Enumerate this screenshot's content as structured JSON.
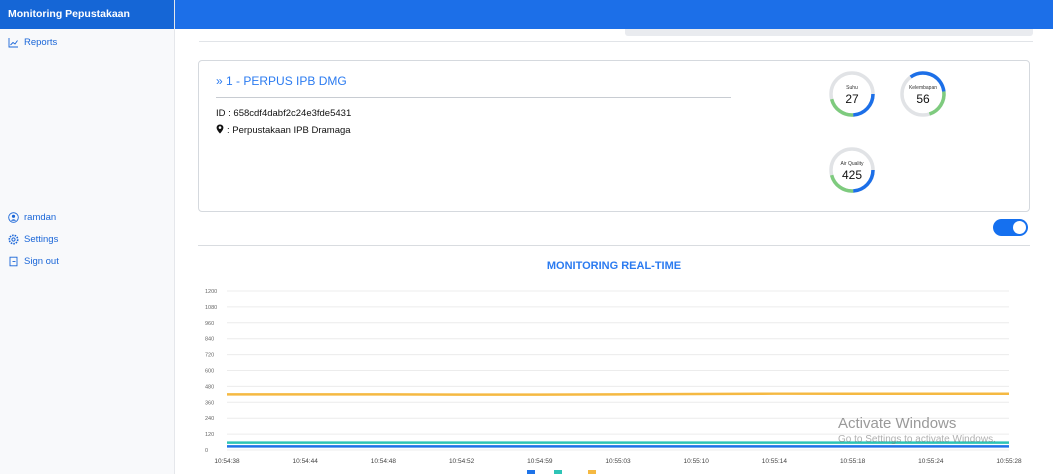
{
  "app": {
    "title": "Monitoring Pepustakaan"
  },
  "sidebar": {
    "top_items": [
      {
        "label": "Reports",
        "icon": "chart-line-icon"
      }
    ],
    "bottom_items": [
      {
        "label": "ramdan",
        "icon": "user-circle-icon"
      },
      {
        "label": "Settings",
        "icon": "gear-icon"
      },
      {
        "label": "Sign out",
        "icon": "sign-out-icon"
      }
    ]
  },
  "device_card": {
    "title": "» 1 - PERPUS IPB DMG",
    "id_text": "ID : 658cdf4dabf2c24e3fde5431",
    "location_text": ": Perpustakaan IPB Dramaga",
    "gauges": [
      {
        "label": "Suhu",
        "value": "27",
        "color": "#1c6fe8",
        "secondary_color": "#7ecb7e"
      },
      {
        "label": "Kelembapan",
        "value": "56",
        "color": "#1c6fe8",
        "secondary_color": "#7ecb7e"
      },
      {
        "label": "Air Quality",
        "value": "425",
        "color": "#1c6fe8",
        "secondary_color": "#7ecb7e"
      }
    ]
  },
  "toggle": {
    "on": true
  },
  "monitoring": {
    "title": "MONITORING REAL-TIME"
  },
  "chart_data": {
    "type": "line",
    "title": "",
    "categories": [
      "10:54:38",
      "10:54:44",
      "10:54:48",
      "10:54:52",
      "10:54:59",
      "10:55:03",
      "10:55:10",
      "10:55:14",
      "10:55:18",
      "10:55:24",
      "10:55:28"
    ],
    "yticks": [
      0,
      120,
      240,
      360,
      480,
      600,
      720,
      840,
      960,
      1080,
      1200
    ],
    "ylim": [
      0,
      1200
    ],
    "grid": true,
    "series": [
      {
        "values": [
          27,
          27,
          27,
          27,
          27,
          27,
          27,
          27,
          27,
          27,
          27
        ],
        "color": "#1e73e8"
      },
      {
        "values": [
          56,
          56,
          56,
          56,
          56,
          56,
          56,
          56,
          56,
          56,
          56
        ],
        "color": "#2ec4b6"
      },
      {
        "values": [
          420,
          420,
          420,
          418,
          418,
          420,
          423,
          425,
          425,
          425,
          425
        ],
        "color": "#f5b942"
      }
    ]
  },
  "watermark": {
    "line1": "Activate Windows",
    "line2": "Go to Settings to activate Windows."
  },
  "colors": {
    "primary": "#1c6fe8",
    "link": "#2b7bf0"
  }
}
